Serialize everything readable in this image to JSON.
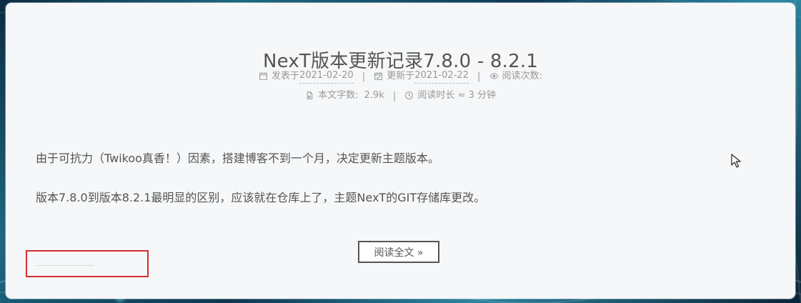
{
  "post": {
    "title": "NexT版本更新记录7.8.0 - 8.2.1",
    "meta": {
      "published_label": "发表于",
      "published_date": "2021-02-20",
      "updated_label": "更新于",
      "updated_date": "2021-02-22",
      "views_label": "阅读次数:",
      "word_count_label": "本文字数:",
      "word_count": "2.9k",
      "reading_time_label": "阅读时长 ≈",
      "reading_time_value": "3 分钟"
    },
    "paragraphs": [
      "由于可抗力（Twikoo真香！）因素，搭建博客不到一个月，决定更新主题版本。",
      "版本7.8.0到版本8.2.1最明显的区别，应该就在仓库上了，主题NexT的GIT存储库更改。"
    ],
    "read_more_label": "阅读全文 »"
  },
  "icons": {
    "published": "calendar-icon",
    "updated": "calendar-check-icon",
    "views": "eye-icon",
    "word_count": "file-word-icon",
    "reading_time": "clock-icon",
    "cursor": "mouse-pointer-icon"
  },
  "colors": {
    "card_background": "#f5f7f9",
    "text": "#555555",
    "meta_text": "#999999",
    "highlight_border": "#d32f2f"
  }
}
